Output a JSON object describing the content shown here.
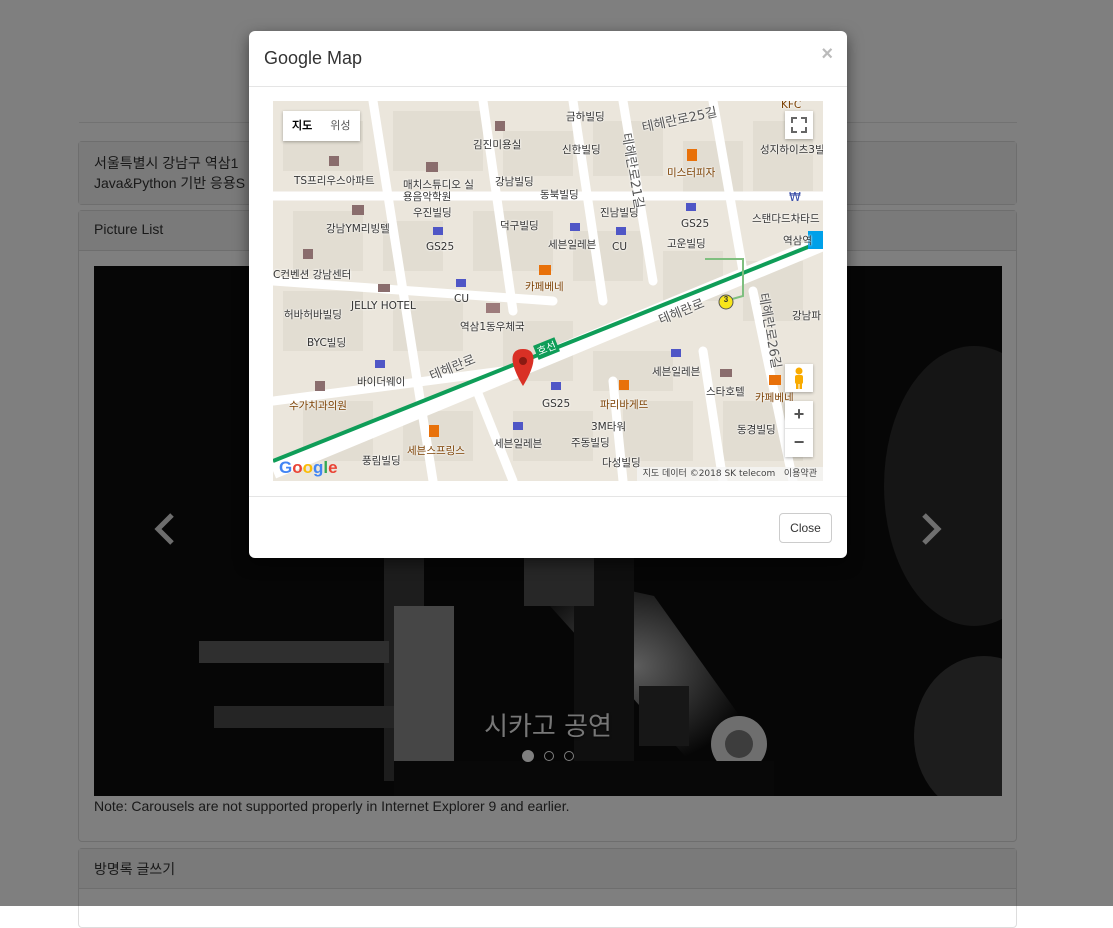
{
  "address": {
    "line1": "서울특별시 강남구 역삼1",
    "line2": "Java&Python 기반 응용S"
  },
  "picture_panel": {
    "title": "Picture List",
    "caption": "시카고 공연",
    "slide_count": 3,
    "active_slide": 1,
    "prev_icon": "chevron-left-icon",
    "next_icon": "chevron-right-icon",
    "note": "Note: Carousels are not supported properly in Internet Explorer 9 and earlier."
  },
  "guestbook": {
    "title": "방명록 글쓰기"
  },
  "modal": {
    "title": "Google Map",
    "close_x": "×",
    "close_button": "Close"
  },
  "map": {
    "type_map": "지도",
    "type_satellite": "위성",
    "zoom_in": "+",
    "zoom_out": "−",
    "footer_data": "지도 데이터 ©2018 SK telecom",
    "footer_terms": "이용약관",
    "logo": "Google",
    "route_badge": "3",
    "labels": {
      "l1": "금하빌딩",
      "l2": "테헤란로25길",
      "l3": "KFC",
      "l4": "김진미용실",
      "l5": "신한빌딩",
      "l6": "성지하이츠3빌",
      "l7": "TS프리우스아파트",
      "l8": "매치스튜디오 실용음악학원",
      "l9": "강남빌딩",
      "l10": "미스터피자",
      "l11": "동북빌딩",
      "l12": "우진빌딩",
      "l13": "진남빌딩",
      "l14": "스탠다드차타드",
      "l15": "강남YM리빙텔",
      "l16": "GS25",
      "l17": "덕구빌딩",
      "l18": "세븐일레븐",
      "l19": "CU",
      "l20": "고운빌딩",
      "l21": "역삼역",
      "l22": "C컨벤션 강남센터",
      "l23": "카페베네",
      "l24": "JELLY HOTEL",
      "l25": "CU",
      "l26": "테헤란로",
      "l27": "허바허바빌딩",
      "l28": "역삼1동우체국",
      "l29": "테헤란로26길",
      "l30": "강남파",
      "l31": "BYC빌딩",
      "l32": "호선",
      "l33": "바이더웨이",
      "l34": "테헤란로",
      "l35": "세븐일레븐",
      "l36": "스타호텔",
      "l37": "수가치과의원",
      "l38": "GS25",
      "l39": "파리바게뜨",
      "l40": "카페베네",
      "l41": "3M타워",
      "l42": "동경빌딩",
      "l43": "세븐스프링스",
      "l44": "세븐일레븐",
      "l45": "주동빌딩",
      "l46": "풍림빌딩",
      "l47": "다성빌딩",
      "l48": "테헤란로21길",
      "l49": "GS25"
    }
  }
}
